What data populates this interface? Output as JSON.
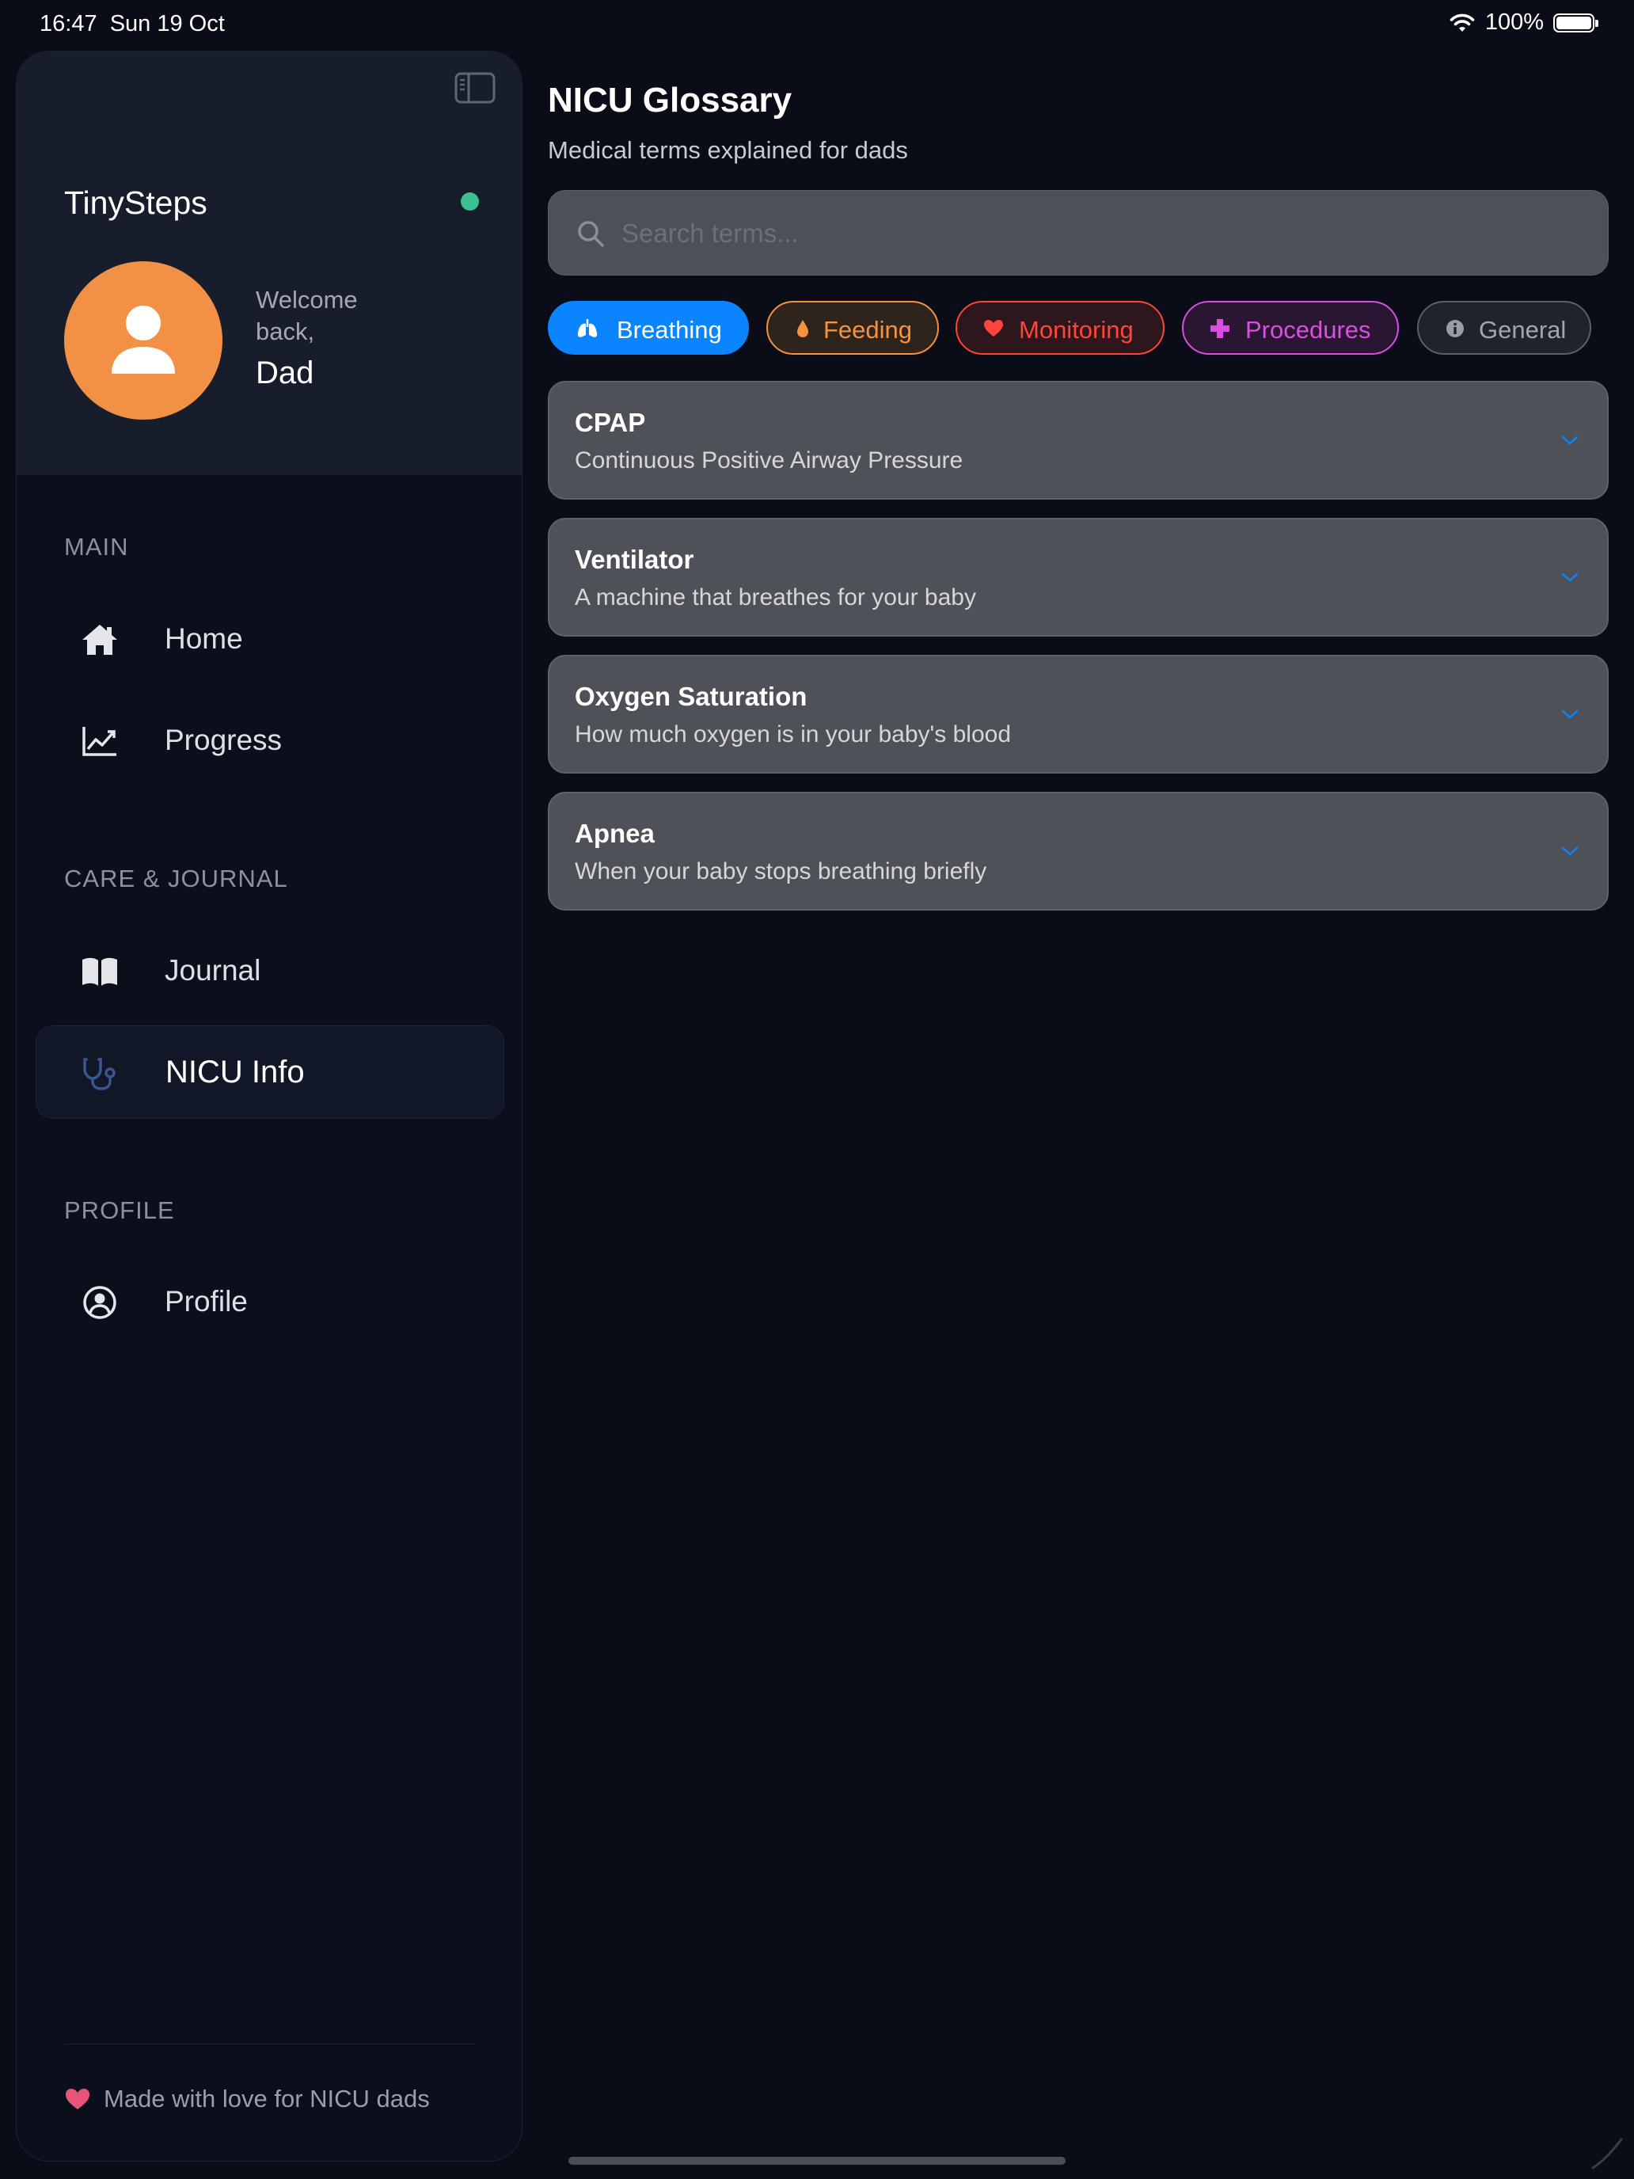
{
  "status_bar": {
    "time": "16:47",
    "date": "Sun 19 Oct",
    "battery": "100%"
  },
  "sidebar": {
    "app_name": "TinySteps",
    "welcome": "Welcome back,",
    "user_name": "Dad",
    "sections": {
      "main": "MAIN",
      "care": "CARE & JOURNAL",
      "profile": "PROFILE"
    },
    "items": {
      "home": "Home",
      "progress": "Progress",
      "journal": "Journal",
      "nicu_info": "NICU Info",
      "profile": "Profile"
    },
    "footer": "Made with love for NICU dads"
  },
  "main": {
    "title": "NICU Glossary",
    "subtitle": "Medical terms explained for dads",
    "search_placeholder": "Search terms...",
    "chips": [
      {
        "label": "Breathing",
        "icon": "lungs-icon"
      },
      {
        "label": "Feeding",
        "icon": "droplet-icon"
      },
      {
        "label": "Monitoring",
        "icon": "heart-icon"
      },
      {
        "label": "Procedures",
        "icon": "plus-icon"
      },
      {
        "label": "General",
        "icon": "info-icon"
      }
    ],
    "terms": [
      {
        "name": "CPAP",
        "description": "Continuous Positive Airway Pressure"
      },
      {
        "name": "Ventilator",
        "description": "A machine that breathes for your baby"
      },
      {
        "name": "Oxygen Saturation",
        "description": "How much oxygen is in your baby's blood"
      },
      {
        "name": "Apnea",
        "description": "When your baby stops breathing briefly"
      }
    ]
  },
  "colors": {
    "accent": "#0a84ff",
    "feeding": "#f5923e",
    "monitoring": "#ff453a",
    "procedures": "#d94fe0",
    "general": "#9a9ca3",
    "avatar": "#f29146",
    "online": "#3dbf94"
  }
}
